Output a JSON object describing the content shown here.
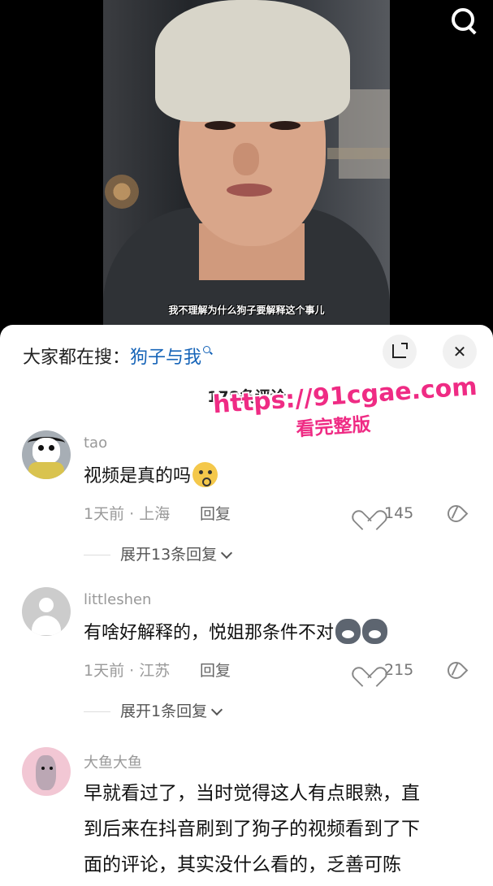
{
  "video": {
    "subtitle": "我不理解为什么狗子要解释这个事儿"
  },
  "sheet": {
    "search_prefix": "大家都在搜：",
    "search_keyword": "狗子与我",
    "comment_count": "178条评论"
  },
  "comments": [
    {
      "user": "tao",
      "text": "视频是真的吗",
      "meta": "1天前 · 上海",
      "reply": "回复",
      "likes": "145",
      "expand": "展开13条回复"
    },
    {
      "user": "littleshen",
      "text": "有啥好解释的，悦姐那条件不对",
      "meta": "1天前 · 江苏",
      "reply": "回复",
      "likes": "215",
      "expand": "展开1条回复"
    },
    {
      "user": "大鱼大鱼",
      "lines": [
        "早就看过了，当时觉得这人有点眼熟，直",
        "到后来在抖音刷到了狗子的视频看到了下",
        "面的评论，其实没什么看的，乏善可陈"
      ]
    }
  ],
  "watermark": {
    "url": "https://91cgae.com",
    "subtitle": "看完整版"
  },
  "icons": {
    "search": "search-icon",
    "expand": "expand-icon",
    "close": "close-icon",
    "like": "heart-icon",
    "dislike": "broken-heart-icon"
  },
  "colors": {
    "keyword": "#1664b8",
    "watermark": "#ef2b84"
  }
}
